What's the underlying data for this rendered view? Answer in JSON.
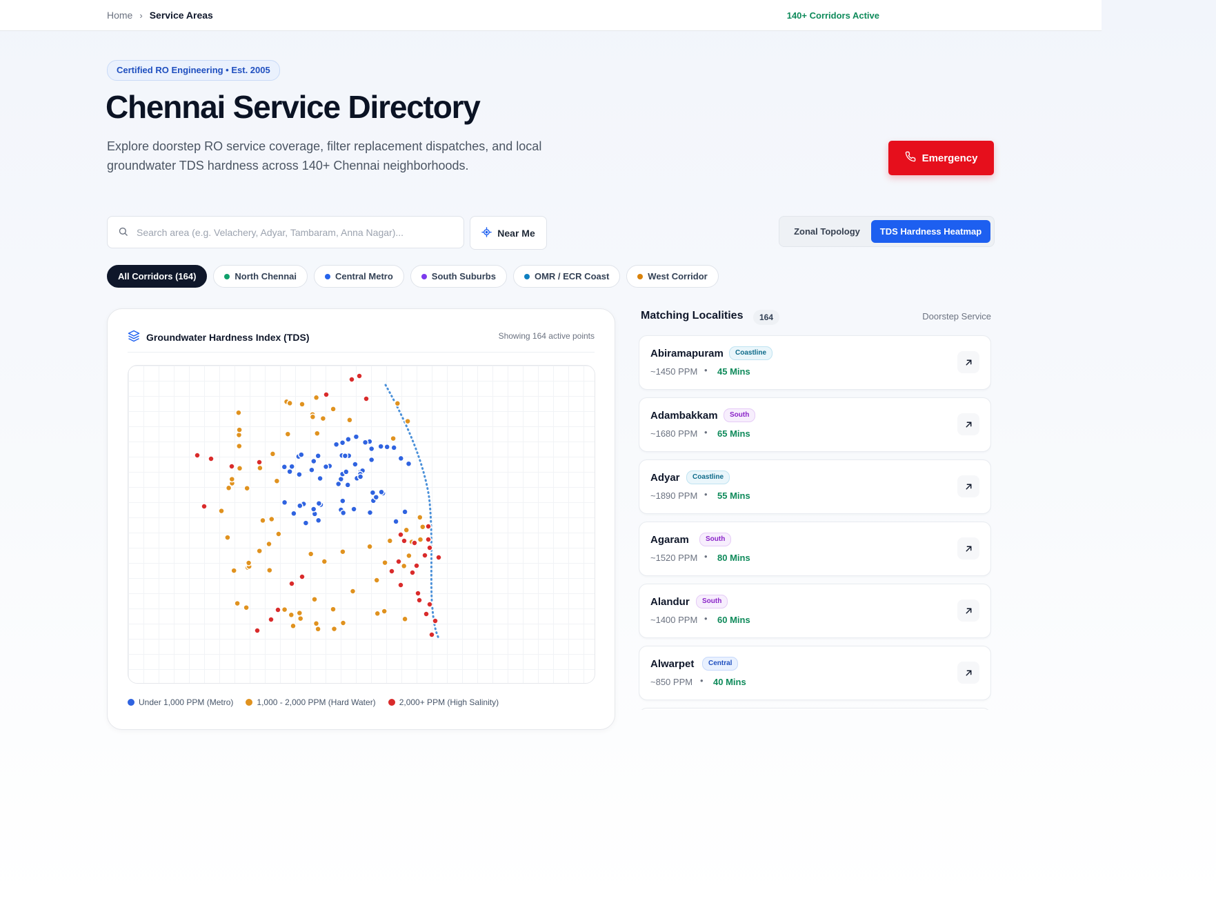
{
  "breadcrumb": {
    "home": "Home",
    "separator": "›",
    "current": "Service Areas"
  },
  "header_status": "140+ Corridors Active",
  "hero": {
    "badge": "Certified RO Engineering • Est. 2005",
    "title": "Chennai Service Directory",
    "subtitle": "Explore doorstep RO service coverage, filter replacement dispatches, and local groundwater TDS hardness across 140+ Chennai neighborhoods.",
    "emergency_label": "Emergency"
  },
  "search": {
    "placeholder": "Search area (e.g. Velachery, Adyar, Tambaram, Anna Nagar)...",
    "value": "",
    "near_me_label": "Near Me"
  },
  "view_toggle": {
    "options": [
      "Zonal Topology",
      "TDS Hardness Heatmap"
    ],
    "selected": "TDS Hardness Heatmap"
  },
  "filters": [
    {
      "label": "All Corridors (164)",
      "active": true,
      "color": ""
    },
    {
      "label": "North Chennai",
      "active": false,
      "color": "#10a06b"
    },
    {
      "label": "Central Metro",
      "active": false,
      "color": "#2563eb"
    },
    {
      "label": "South Suburbs",
      "active": false,
      "color": "#7c3aed"
    },
    {
      "label": "OMR / ECR Coast",
      "active": false,
      "color": "#0e7fc0"
    },
    {
      "label": "West Corridor",
      "active": false,
      "color": "#d9820a"
    }
  ],
  "map": {
    "title": "Groundwater Hardness Index (TDS)",
    "count_label": "Showing 164 active points",
    "colors": {
      "metro": "#2f63e0",
      "hard": "#e0921f",
      "salinity": "#d92b2b",
      "coast_line": "#4a90d9"
    },
    "legend": [
      {
        "label": "Under 1,000 PPM (Metro)",
        "color": "#2f63e0"
      },
      {
        "label": "1,000 - 2,000 PPM (Hard Water)",
        "color": "#e0921f"
      },
      {
        "label": "2,000+ PPM (High Salinity)",
        "color": "#d92b2b"
      }
    ]
  },
  "list": {
    "title": "Matching Localities",
    "count": "164",
    "right_label": "Doorstep Service",
    "items": [
      {
        "name": "Abiramapuram",
        "tag": "Coastline",
        "tag_type": "coast",
        "ppm": "~1450 PPM",
        "eta": "45 Mins"
      },
      {
        "name": "Adambakkam",
        "tag": "South",
        "tag_type": "south",
        "ppm": "~1680 PPM",
        "eta": "65 Mins"
      },
      {
        "name": "Adyar",
        "tag": "Coastline",
        "tag_type": "coast",
        "ppm": "~1890 PPM",
        "eta": "55 Mins"
      },
      {
        "name": "Agaram",
        "tag": "South",
        "tag_type": "south",
        "ppm": "~1520 PPM",
        "eta": "80 Mins"
      },
      {
        "name": "Alandur",
        "tag": "South",
        "tag_type": "south",
        "ppm": "~1400 PPM",
        "eta": "60 Mins"
      },
      {
        "name": "Alwarpet",
        "tag": "Central",
        "tag_type": "central",
        "ppm": "~850 PPM",
        "eta": "40 Mins"
      }
    ]
  }
}
